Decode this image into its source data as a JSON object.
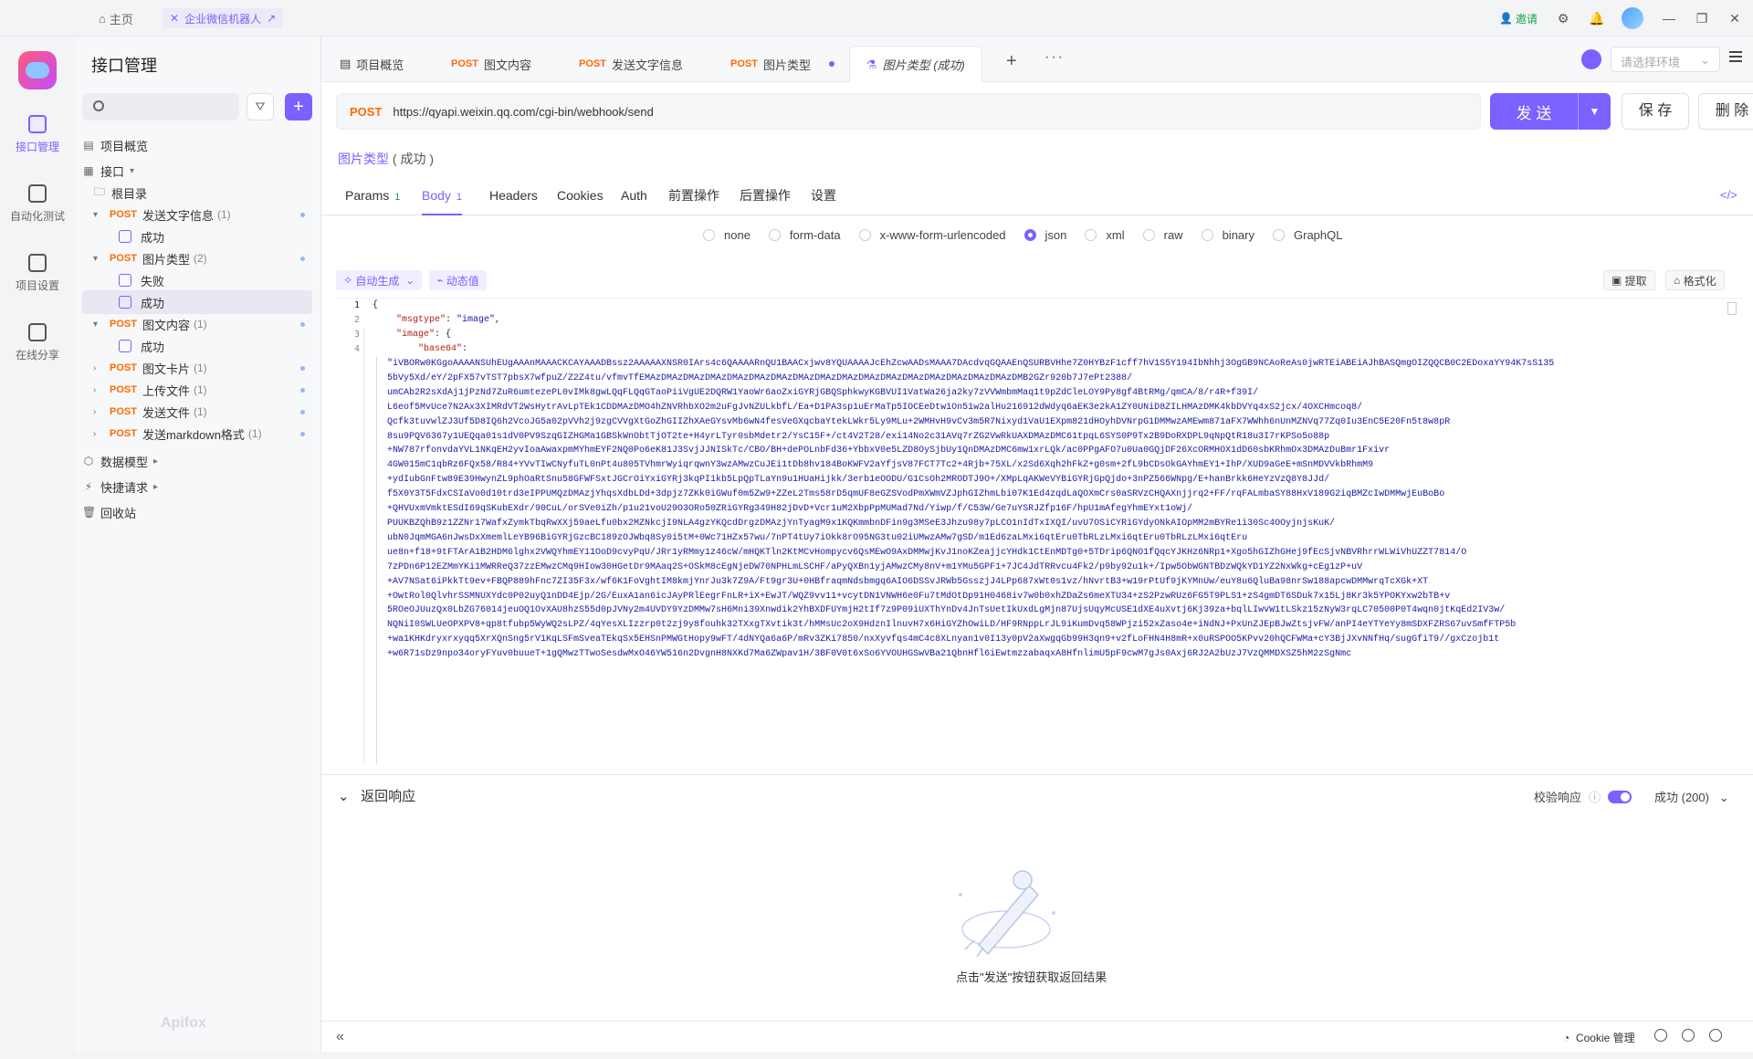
{
  "titlebar": {
    "home": "主页",
    "project_tab": "企业微信机器人",
    "invite": "邀请"
  },
  "rail": {
    "items": [
      {
        "label": "接口管理",
        "icon": "api-manage-icon"
      },
      {
        "label": "自动化测试",
        "icon": "automation-icon"
      },
      {
        "label": "项目设置",
        "icon": "settings-icon"
      },
      {
        "label": "在线分享",
        "icon": "share-icon"
      }
    ],
    "brand": "Apifox"
  },
  "sidebar": {
    "title": "接口管理",
    "overview": "项目概览",
    "api_group": "接口",
    "root": "根目录",
    "items": [
      {
        "method": "POST",
        "name": "发送文字信息",
        "count": "(1)"
      },
      {
        "case": "成功"
      },
      {
        "method": "POST",
        "name": "图片类型",
        "count": "(2)"
      },
      {
        "case": "失败"
      },
      {
        "case": "成功"
      },
      {
        "method": "POST",
        "name": "图文内容",
        "count": "(1)"
      },
      {
        "case": "成功"
      },
      {
        "method": "POST",
        "name": "图文卡片",
        "count": "(1)"
      },
      {
        "method": "POST",
        "name": "上传文件",
        "count": "(1)"
      },
      {
        "method": "POST",
        "name": "发送文件",
        "count": "(1)"
      },
      {
        "method": "POST",
        "name": "发送markdown格式",
        "count": "(1)"
      }
    ],
    "data_model": "数据模型",
    "quick_request": "快捷请求",
    "recycle": "回收站"
  },
  "tabs": [
    {
      "method": "",
      "label": "项目概览"
    },
    {
      "method": "POST",
      "label": "图文内容"
    },
    {
      "method": "POST",
      "label": "发送文字信息"
    },
    {
      "method": "POST",
      "label": "图片类型"
    },
    {
      "method": "",
      "label": "图片类型 (成功)"
    }
  ],
  "env": {
    "placeholder": "请选择环境"
  },
  "request": {
    "method": "POST",
    "url": "https://qyapi.weixin.qq.com/cgi-bin/webhook/send",
    "send": "发 送",
    "save": "保 存",
    "delete": "删 除",
    "case_name": "图片类型",
    "case_status": "( 成功 )"
  },
  "req_tabs": [
    {
      "label": "Params",
      "count": "1"
    },
    {
      "label": "Body",
      "count": "1"
    },
    {
      "label": "Headers",
      "count": ""
    },
    {
      "label": "Cookies",
      "count": ""
    },
    {
      "label": "Auth",
      "count": ""
    },
    {
      "label": "前置操作",
      "count": ""
    },
    {
      "label": "后置操作",
      "count": ""
    },
    {
      "label": "设置",
      "count": ""
    }
  ],
  "body_types": [
    "none",
    "form-data",
    "x-www-form-urlencoded",
    "json",
    "xml",
    "raw",
    "binary",
    "GraphQL"
  ],
  "body_selected": "json",
  "editor": {
    "auto_gen": "自动生成",
    "dynamic": "动态值",
    "extract": "提取",
    "format": "格式化",
    "line_numbers": [
      "1",
      "2",
      "3",
      "4"
    ],
    "lines": [
      "{",
      "\"msgtype\": \"image\",",
      "\"image\": {",
      "\"base64\":"
    ],
    "msgtype_key": "\"msgtype\"",
    "msgtype_val": "\"image\"",
    "image_key": "\"image\"",
    "base64_key": "\"base64\"",
    "base64_lines": [
      "\"iVBORw0KGgoAAAANSUhEUgAAAnMAAACKCAYAAADBssz2AAAAAXNSR0IArs4c6QAAAARnQU1BAACxjwv8YQUAAAAJcEhZcwAADsMAAA7DAcdvqGQAAEnQSURBVHhe7Z0HYBzF1cff7hV1S5Y194IbNhhj3OgGB9NCAoReAs0jwRTEiABEiAJhBASQmgOIZQQCB0C2EDoxaYY94K7sS135",
      "5bVy5Xd/eY/2pFX57vTST7pbsX7wfpuZ/Z2Z4tu/vfmvTfEMAzDMAzDMAzDMAzDMAzDMAzDMAzDMAzDMAzDMAzDMAzDMAzDMAzDMAzDMAzDMAzDMAzDMB2GZr920b7J7ePt2388/",
      "umCAb2R2sXdAj1jPzNd7ZuR6umtezePL0vIMk8gwLQqFLQqGTaoPiiVgUE2DQRW1YaoWr6aoZxiGYRjGBQSphkwyKGBVUI1VatWa26ja2ky7zVVWmbmMaq1t9pZdCleLOY9Py8gf4BtRMg/qmCA/8/r4R+f39I/",
      "L6eof5MvUce7N2Ax3XIMRdVT2WsHytrAvLpTEk1CDDMAzDMO4hZNVRhbXO2m2uFgJvNZULkbfL/Ea+D1PA3sp1uErMaTp5IOCEeDtw1On51w2alHu216912dWdyq6aEK3e2kA1ZY0UNiD8ZILHMAzDMK4kbDVYq4xS2jcx/4OXCHmcoq8/",
      "Qcfk3tuvwlZJ3Uf5D8IQ6h2VcoJG5a02pVVh2j9zgCVVgXtGoZhGIIZhXAeGYsvMb6wN4fesVeGXqcbaYtekLWkr5Ly9MLu+2WMHvH9vCv3m5R7Nixyd1VaU1EXpm821dHOyhDVNrpG1DMMwzAMEwm871aFX7WWhh6nUnMZNVq77Zq0Iu3EnC5E20Fn5t8w8pR",
      "8su9PQV6367y1UEQqa01s1dV0PV9SzqGIZHGMa1GBSkWnObtTjOT2te+H4yrLTyr0sbMdetr2/YsC15F+/ct4V2T28/exi14No2c31AVq7rZG2VwRkUAXDMAzDMC61tpqL6SYS0P9Tx2B9DoRXDPL9qNpQtR18u3I7rKPSo5o88p",
      "+NW787rfonvdaYVL1NKqEH2yvIoaAwaxpmMYhmEYF2NQ0Po6eK81J3SvjJJNISkTc/CBO/BH+dePOLnbFd36+YbbxV0e5LZD8OySjbUy1QnDMAzDMC6mw1xrLQk/ac0PPgAFO7u0Ua0GQjDF26XcORMHOX1dD60sbKRhmOx3DMAzDuBmr1Fxivr",
      "4GW015mC1qbRz6FQx58/R84+YVvTIwCNyfuTL0nPt4u805TVhmrWyiqrqwnY3wzAMwzCuJEi1tDb8hv184BoKWFV2aYfjsV87FCT7Tc2+4Rjb+75XL/x2Sd6Xqh2hFkZ+g0sm+2fL9bCDsOkGAYhmEY1+IhP/XUD9aGeE+mSnMDVVkbRhmM9",
      "+ydIubGnFtw89E39HwynZL9phOaRtSnu58GFWFSxtJGCrOiYxiGYRj3kqPI1kb5LpQpTLaYn9u1HUaHijkk/3erb1eOODU/G1CsOh2MRODTJ9O+/XMpLqAKWeVYBiGYRjGpQjdo+3nPZ566WNpg/E+hanBrkk6HeYzVzQ8Y8JJd/",
      "f5X0Y3T5FdxCSIaVo0d10trd3eIPPUMQzDMAzjYhqsXdbLDd+3dpjz7ZKk0iGWuf0m5Zw9+ZZeL2Tms58rD5qmUF8eGZSVodPmXWmVZJphGIZhmLbi07K1Ed4zqdLaQOXmCrs0aSRVzCHQAXnjjrq2+FF/rqFALmbaSY88HxV189G2iqBMZcIwDMMwjEuBoBo",
      "+QHVUxmVmktESdI69qSKubEXdr/90CuL/orSVe0iZh/p1u21voU29O3ORo50ZRiGYRg349H82jDvD+Vcr1uM2XbpPpMUMad7Nd/Yiwp/f/C53W/Ge7uYSRJZfp16F/hpU1mAfegYhmEYxt1oWj/",
      "PUUKBZQhB9z1ZZNr17WafxZymkTbqRwXXj59aeLfu0bx2MZNkcjI9NLA4gzYKQcdDrgzDMAzjYnTyagM9x1KQKmmbnDFin9g3MSeE3Jhzu98y7pLCO1nIdTxIXQI/uvU7OSiCYRiGYdyONkAIOpMM2mBYRe1i30Sc4OOyjnjsKuK/",
      "ubN0JqmMGA6nJwsDxXmemlLeYB96BiGYRjGzcBC189zOJWbq8Sy0i5tM+0Wc71HZx57wu/7nPT4tUy7iOkk8rO95NG3tu02iUMwzAMw7gSD/m1Ed6zaLMxi6qtEru0TbRLzLMxi6qtEru0TbRLzLMxi6qtEru",
      "ue8n+f18+9tFTArA1B2HDM6lghx2VWQYhmEY11OoD9cvyPqU/JRr1yRMmy1z46cW/mHQKTln2KtMCvHompycv6QsMEwO9AxDMMwjKvJ1noKZeajjcYHdk1CtEnMDTg0+5TDrip6QNO1fQqcYJKHz6NRp1+Xgo5hGIZhGHej9fEcSjvNBVRhrrWLWiVhUZZT7814/O",
      "7zPDn6P12EZMmYKi1MWRReQ37zzEMwzCMq9HIow30HGetDr9MAaq2S+OSkM8cEgNjeDW70NPHLmLSCHF/aPyQXBn1yjAMwzCMy8nV+m1YMu5GPF1+7JC4JdTRRvcu4Fk2/p9by92u1k+/Ipw5ObWGNTBDzWQkYD1YZ2NxWkg+cEg1zP+uV",
      "+AV7NSat6iPkkTt9ev+FBQP889hFnc7ZI35F3x/wf6K1FoVghtIM8kmjYnrJu3k7Z9A/Ft9gr3U+0HBfraqmNdsbmgq6AIO6DSSvJRWb5GsszjJ4LPp687xWt0s1vz/hNvrtB3+w19rPtUf9jKYMnUw/euY8u6QluBa98nrSw188apcwDMMwrqTcXGk+XT",
      "+OwtRol0QlvhrSSMNUXYdc0P02uyQ1nDD4Ejp/2G/EuxA1an6icJAyPRlEegrFnLR+iX+EwJT/WQZ9vv11+vcytDN1VNWH6e0Fu7tMdOtDp91H0468iv7w0b0xhZDaZs6meXTU34+zS2PzwRUz6FG5T9PLS1+zS4gmDT6SDuk7x15Lj8Kr3k5YPOKYxw2bTB+v",
      "5ROeOJUuzQx0LbZG76014jeuOQ1OvXAU8hzS55d0pJVNy2m4UVDY9YzDMMw7sH6Mni39Xnwdik2YhBXDFUYmjH2tIf7z9P09iUXThYnDv4JnTsUetIkUxdLgMjn87UjsUqyMcUSE1dXE4uXvtj6Kj39za+bqlLIwvW1tLSkz15zNyW3rqLC70500P0T4wqn0jtKqEd2IV3w/",
      "NQNiI0SWLUeOPXPV8+qp8tfubp5WyWQ2sLPZ/4qYesXLIzzrp0t2zj9y8fouhk32TXxgTXvtik3t/hMMsUc2oX9HdznIlnuvH7x6HiGYZhOwiLD/HF9RNppLrJL9iKumDvq58WPjzi52xZaso4e+iNdNJ+PxUnZJEpBJwZtsjvFW/anPI4eYTYeYy8mSDXFZRS67uvSmfFTP5b",
      "+wa1KHKdryxrxyqq5XrXQnSng5rV1KqLSFmSveaTEkqSx5EHSnPMWGtHopy9wFT/4dNYQa6a6P/mRv3ZKi7850/nxXyvfqs4mC4c8XLnyan1v0I13y0pV2aXwgqGb99H3qn9+v2fLoFHN4H8mR+x0uRSPOO5KPvv20hQCFWMa+cY3BjJXvNNfHq/sugGfiT9//gxCzojb1t",
      "+w6R71sDz9npo34oryFYuv0buueT+1gQMwzTTwoSesdwMxO46YW516n2DvgnH8NXKd7Ma6ZWpav1H/3BF0V0t6xSo6YVOUHGSwVBa21QbnHfl6iEwtmzzabaqxA8HfnlimU5pF9cwM7gJs0Axj6RJ2A2bUzJ7VzQMMDXSZ5hM2zSgNmc"
    ]
  },
  "response": {
    "title": "返回响应",
    "validate": "校验响应",
    "status": "成功 (200)",
    "empty_hint": "点击\"发送\"按钮获取返回结果"
  },
  "footer": {
    "cookie": "Cookie 管理"
  },
  "colors": {
    "accent": "#7b61ff",
    "method_post": "#ff6a00",
    "success_green": "#16a34a"
  }
}
